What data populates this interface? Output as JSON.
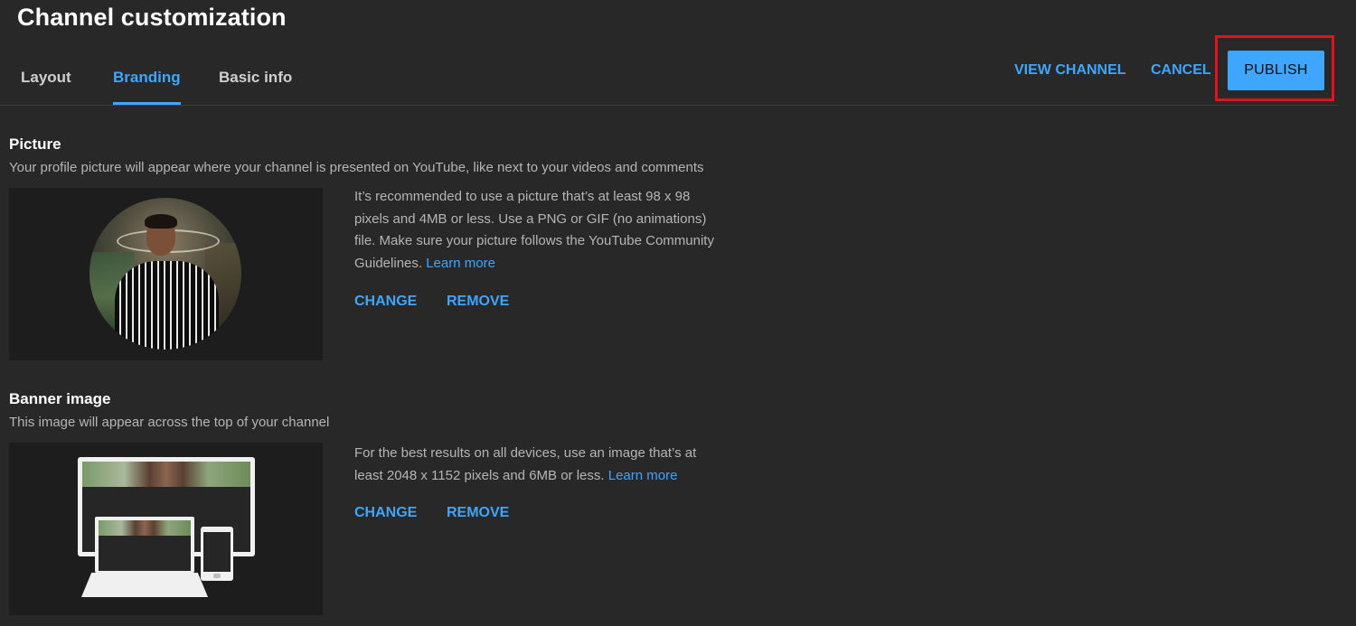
{
  "header": {
    "title": "Channel customization",
    "view_channel_label": "VIEW CHANNEL",
    "cancel_label": "CANCEL",
    "publish_label": "PUBLISH"
  },
  "tabs": [
    {
      "label": "Layout",
      "active": false
    },
    {
      "label": "Branding",
      "active": true
    },
    {
      "label": "Basic info",
      "active": false
    }
  ],
  "picture": {
    "title": "Picture",
    "description": "Your profile picture will appear where your channel is presented on YouTube, like next to your videos and comments",
    "info_text": "It’s recommended to use a picture that’s at least 98 x 98 pixels and 4MB or less. Use a PNG or GIF (no animations) file. Make sure your picture follows the YouTube Community Guidelines.",
    "learn_more_label": "Learn more",
    "change_label": "CHANGE",
    "remove_label": "REMOVE"
  },
  "banner": {
    "title": "Banner image",
    "description": "This image will appear across the top of your channel",
    "info_text": "For the best results on all devices, use an image that’s at least 2048 x 1152 pixels and 6MB or less.",
    "learn_more_label": "Learn more",
    "change_label": "CHANGE",
    "remove_label": "REMOVE"
  },
  "colors": {
    "accent": "#3ea6ff",
    "background": "#282828",
    "highlight": "#e0121c"
  }
}
